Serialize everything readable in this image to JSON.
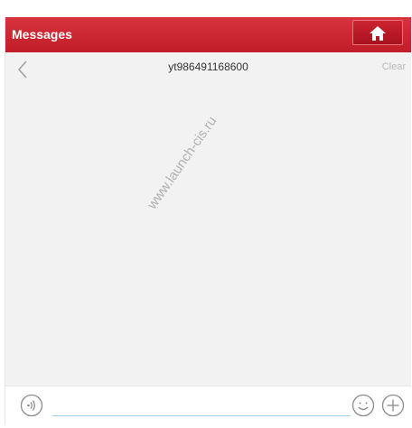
{
  "titlebar": {
    "title": "Messages",
    "home_icon": "home-icon"
  },
  "chat": {
    "contact_id": "yt986491168600",
    "back_icon": "chevron-left-icon",
    "clear_label": "Clear"
  },
  "watermark": "www.launch-cis.ru",
  "input": {
    "value": "",
    "voice_icon": "voice-icon",
    "emoji_icon": "smiley-icon",
    "more_icon": "plus-circle-icon"
  },
  "colors": {
    "brand_red": "#c4202c",
    "background": "#f2f2f2",
    "input_underline": "#9fd0e8"
  }
}
